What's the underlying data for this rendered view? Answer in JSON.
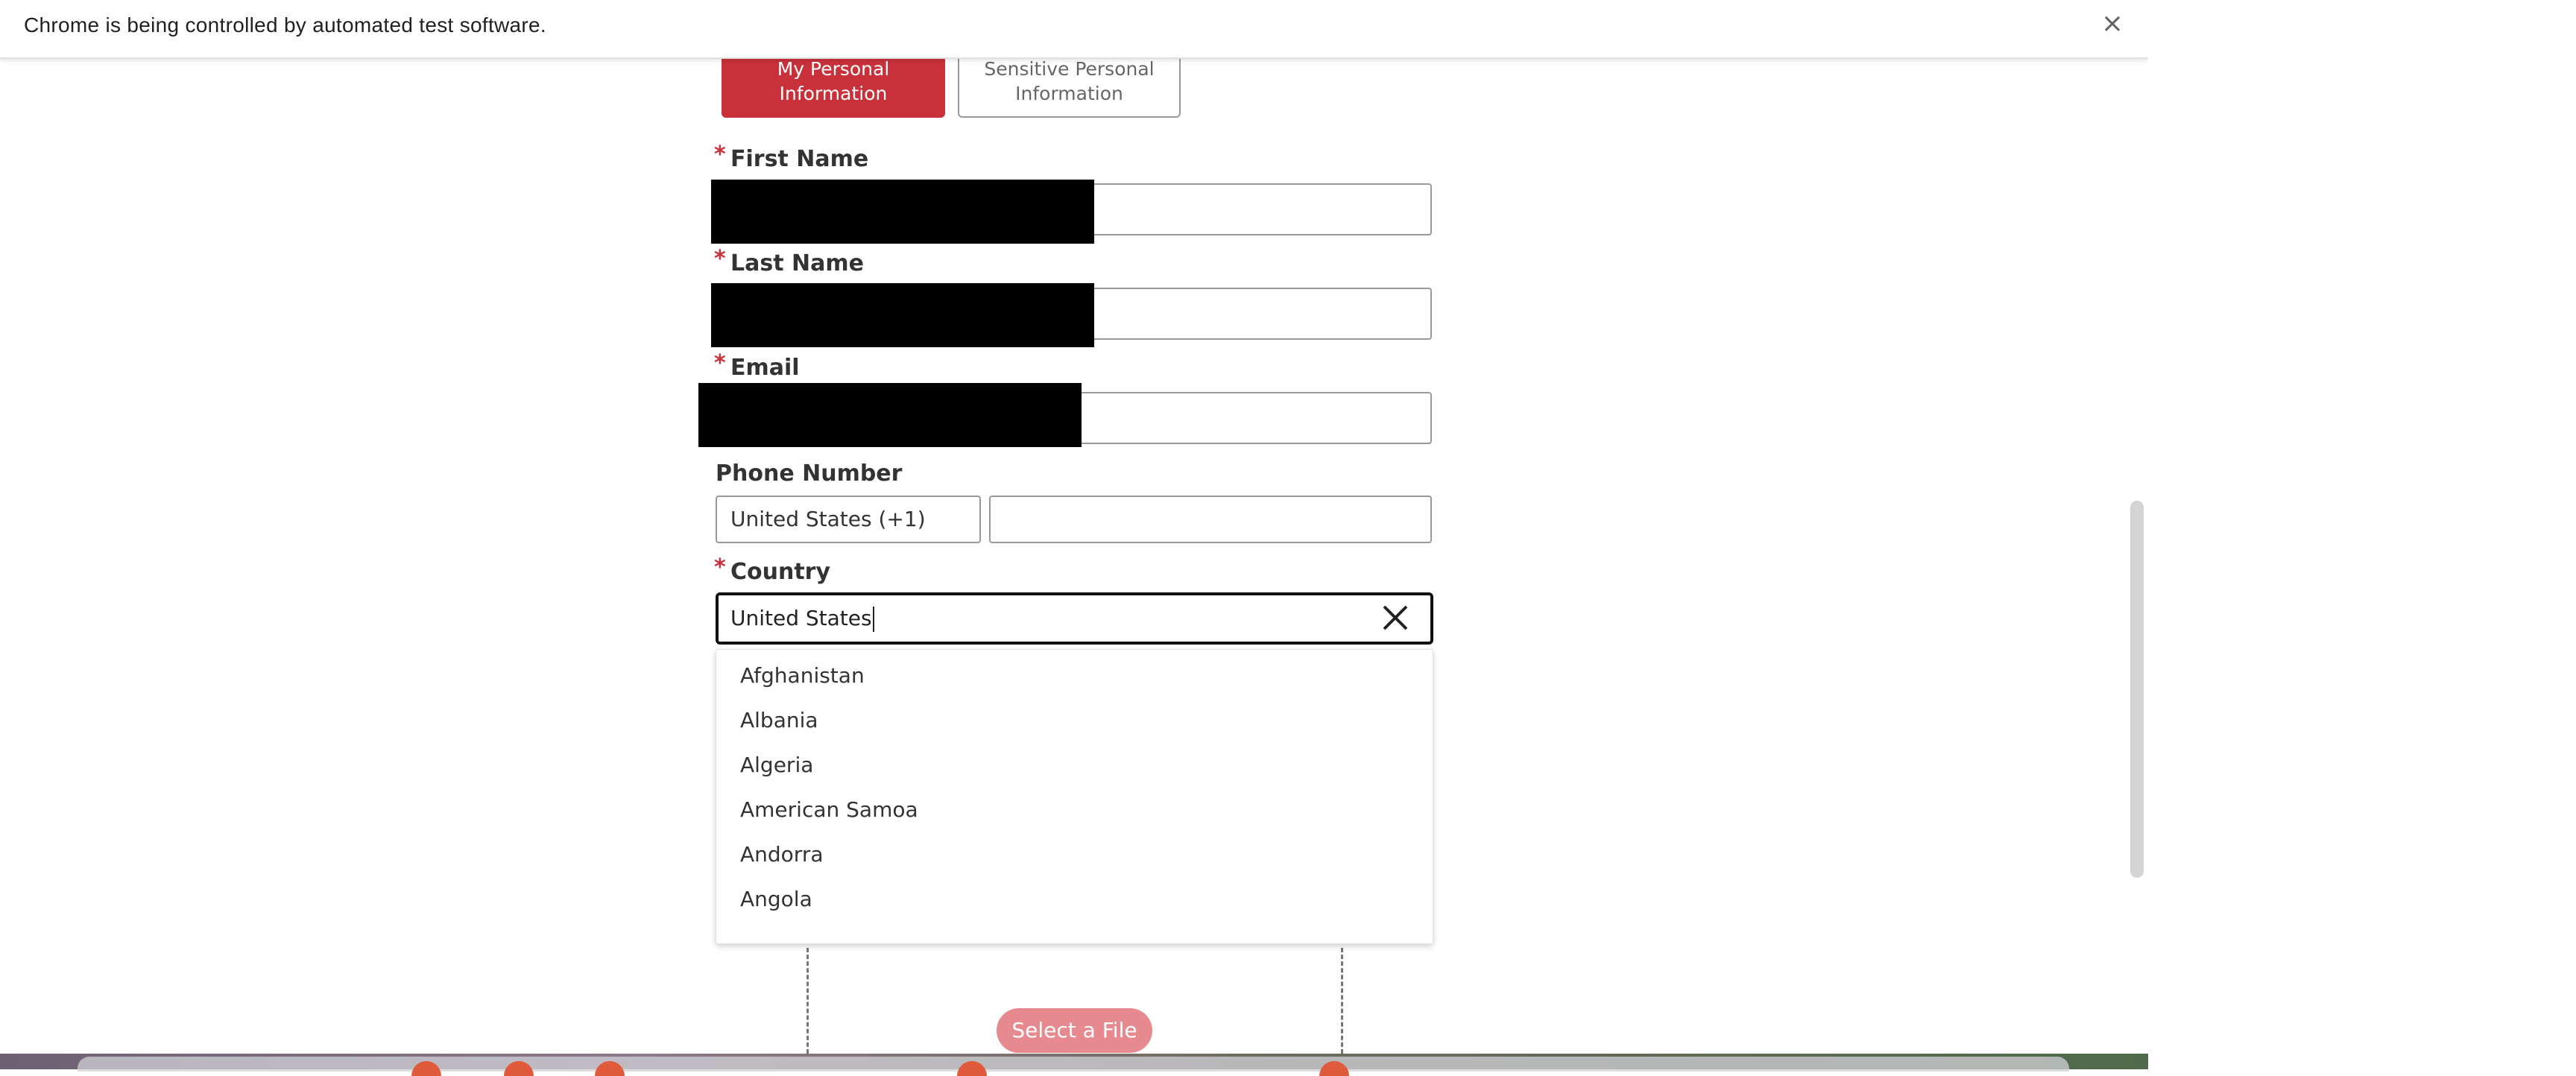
{
  "infobar": {
    "message": "Chrome is being controlled by automated test software.",
    "close_glyph": "×"
  },
  "tabs": [
    {
      "label": "My Personal Information",
      "active": true
    },
    {
      "label": "Sensitive Personal Information",
      "active": false
    }
  ],
  "form": {
    "required_marker": "*",
    "first_name_label": "First Name",
    "last_name_label": "Last Name",
    "email_label": "Email",
    "phone_label": "Phone Number",
    "phone_country_code": "United States (+1)",
    "country_label": "Country",
    "country_value": "United States"
  },
  "country_options": [
    "Afghanistan",
    "Albania",
    "Algeria",
    "American Samoa",
    "Andorra",
    "Angola"
  ],
  "file_upload": {
    "button_label": "Select a File"
  },
  "colors": {
    "accent": "#c8303a",
    "accent_light": "#e78a90"
  }
}
